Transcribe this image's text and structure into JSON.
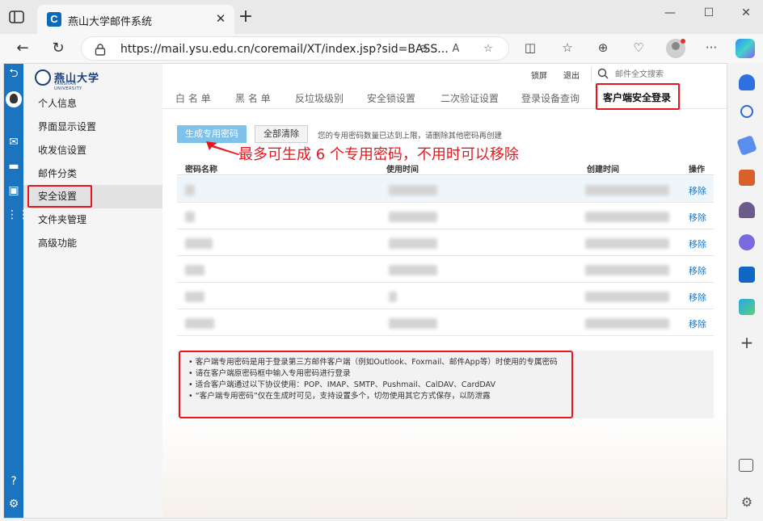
{
  "browser": {
    "tab_title": "燕山大学邮件系统",
    "tab_favicon_letter": "C",
    "url": "https://mail.ysu.edu.cn/coremail/XT/index.jsp?sid=BASS...",
    "window_buttons": {
      "minimize": "—",
      "maximize": "☐",
      "close": "✕"
    }
  },
  "school": {
    "name": "燕山大学",
    "subtitle": "YANSHAN UNIVERSITY"
  },
  "header": {
    "lock_label": "锁屏",
    "logout_label": "退出",
    "search_placeholder": "邮件全文搜索"
  },
  "menu": {
    "items": [
      {
        "label": "个人信息"
      },
      {
        "label": "界面显示设置"
      },
      {
        "label": "收发信设置"
      },
      {
        "label": "邮件分类"
      },
      {
        "label": "安全设置",
        "active": true
      },
      {
        "label": "文件夹管理"
      },
      {
        "label": "高级功能"
      }
    ]
  },
  "tabs": [
    {
      "label": "白 名 单"
    },
    {
      "label": "黑 名 单"
    },
    {
      "label": "反垃圾级别"
    },
    {
      "label": "安全锁设置"
    },
    {
      "label": "二次验证设置"
    },
    {
      "label": "登录设备查询"
    },
    {
      "label": "客户端安全登录",
      "active": true
    }
  ],
  "actions": {
    "generate_label": "生成专用密码",
    "clear_label": "全部清除",
    "hint": "您的专用密码数量已达到上限，请删除其他密码再创建"
  },
  "annotation": "最多可生成 6 个专用密码，不用时可以移除",
  "table": {
    "headers": {
      "name": "密码名称",
      "used": "使用时间",
      "created": "创建时间",
      "op": "操作"
    },
    "rows": [
      {
        "op": "移除"
      },
      {
        "op": "移除"
      },
      {
        "op": "移除"
      },
      {
        "op": "移除"
      },
      {
        "op": "移除"
      },
      {
        "op": "移除"
      }
    ]
  },
  "notes": [
    "• 客户端专用密码是用于登录第三方邮件客户端（例如Outlook、Foxmail、邮件App等）时使用的专属密码",
    "• 请在客户端原密码框中输入专用密码进行登录",
    "• 适合客户端通过以下协议使用：POP、IMAP、SMTP、Pushmail、CalDAV、CardDAV",
    "• “客户端专用密码”仅在生成时可见，支持设置多个，切勿使用其它方式保存，以防泄露"
  ],
  "colors": {
    "accent": "#1a74bf",
    "annotation": "#e8161b",
    "generate_button": "#7fc1e8"
  }
}
